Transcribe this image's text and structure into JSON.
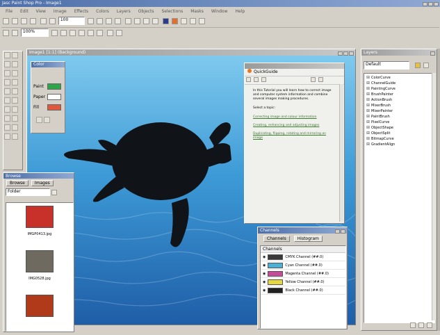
{
  "app": {
    "title": "Jasc Paint Shop Pro - Image1"
  },
  "menu": [
    "File",
    "Edit",
    "View",
    "Image",
    "Effects",
    "Colors",
    "Layers",
    "Objects",
    "Selections",
    "Masks",
    "Window",
    "Help"
  ],
  "toolbar": {
    "zoom": "100%",
    "zoom2": "100"
  },
  "tools": [
    "arrow-tool",
    "pan-tool",
    "zoom-tool",
    "crop-tool",
    "move-tool",
    "select-tool",
    "freehand-tool",
    "wand-tool",
    "dropper-tool",
    "brush-tool",
    "clone-tool",
    "replace-tool",
    "retouch-tool",
    "eraser-tool",
    "picture-tube-tool",
    "airbrush-tool",
    "fill-tool",
    "text-tool",
    "line-tool",
    "shape-tool"
  ],
  "image_window": {
    "title": "Image1 [1:1] (Background)"
  },
  "colors_palette": {
    "title": "Color",
    "paint_label": "Paint",
    "paper_label": "Paper",
    "fill_label": "Fill",
    "paint_color": "#2ea54a",
    "paper_color": "#ffffff",
    "fill_color": "#e0583c"
  },
  "quickguide": {
    "title": "QuickGuide",
    "header": "QuickGuide",
    "intro": "In this Tutorial you will learn how to correct image and computer system information and combine several images making procedures.",
    "select": "Select a topic:",
    "links": [
      "Correcting image and colour information",
      "Creating, enhancing and adjusting images",
      "Duplicating, flipping, rotating and mirroring an image"
    ]
  },
  "browser": {
    "title": "Browse",
    "tab_browse": "Browse",
    "tab_images": "Images",
    "folder": "Folder",
    "files": [
      {
        "name": "IMGP0413.jpg",
        "color": "#c8302a"
      },
      {
        "name": "IMG0528.jpg",
        "color": "#6e6a60"
      },
      {
        "name": "",
        "color": "#b03a1a"
      }
    ]
  },
  "channels": {
    "title": "Channels",
    "tab_channels": "Channels",
    "tab_histogram": "Histogram",
    "header": "Channels",
    "rows": [
      {
        "name": "CMYK Channel (##.0)",
        "color": "#3a3a3a"
      },
      {
        "name": "Cyan Channel (##.0)",
        "color": "#4ab0d8"
      },
      {
        "name": "Magenta Channel (##.0)",
        "color": "#c84a9a"
      },
      {
        "name": "Yellow Channel (##.0)",
        "color": "#e8d840"
      },
      {
        "name": "Black Channel (##.0)",
        "color": "#202020"
      }
    ]
  },
  "layers": {
    "title": "Layers",
    "select_value": "Default",
    "items": [
      "ColorCurve",
      "ChannelGuide",
      "PaintingCurve",
      "BrushPainter",
      "ActionBrush",
      "MixerBrush",
      "MixerPainter",
      "PaintBrush",
      "PixelCurve",
      "ObjectShape",
      "ObjectSplit",
      "BitmapCurve",
      "GradientAlign"
    ]
  }
}
